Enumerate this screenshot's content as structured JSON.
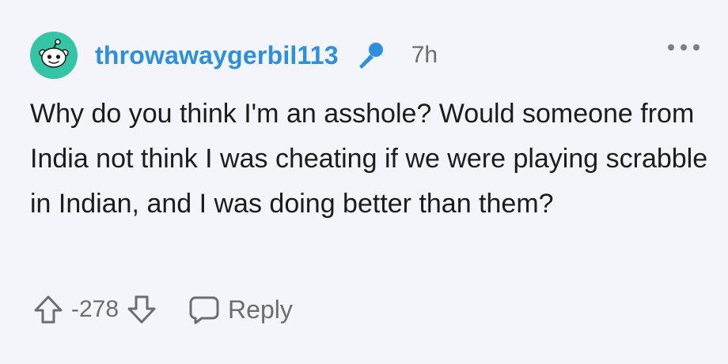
{
  "comment": {
    "author": "throwawaygerbil113",
    "flair_icon": "microphone-icon",
    "time_ago": "7h",
    "body": "Why do you think I'm an asshole? Would someone from India not think I was cheating if we were playing scrabble in Indian, and I was doing better than them?",
    "score": "-278",
    "reply_label": "Reply"
  },
  "icons": {
    "avatar": "snoo-avatar-icon",
    "more": "more-options-icon",
    "upvote": "upvote-arrow-icon",
    "downvote": "downvote-arrow-icon",
    "reply": "speech-bubble-icon"
  },
  "colors": {
    "background": "#f3f5fa",
    "username": "#2d8fe0",
    "avatar_bg": "#34c5a6",
    "flair": "#2d8fe0",
    "muted": "#6a6d72",
    "text": "#1c1c1c"
  }
}
